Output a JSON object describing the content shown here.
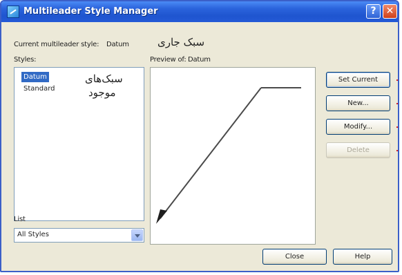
{
  "window": {
    "title": "Multileader Style Manager"
  },
  "titlebar_buttons": {
    "help": "?",
    "close": "✕"
  },
  "current_style": {
    "label": "Current multileader style:",
    "value": "Datum"
  },
  "annotations": {
    "current_style_fa": "سبک جاری",
    "styles_fa_line1": "سبک‌های",
    "styles_fa_line2": "موجود"
  },
  "styles": {
    "label": "Styles:",
    "items": [
      "Datum",
      "Standard"
    ],
    "selected": "Datum"
  },
  "preview": {
    "label": "Preview of:",
    "value": "Datum"
  },
  "list": {
    "label": "List",
    "selected": "All Styles"
  },
  "buttons": {
    "set_current": "Set Current",
    "new": "New...",
    "modify": "Modify...",
    "delete": "Delete",
    "close": "Close",
    "help": "Help"
  },
  "colors": {
    "title_bar": "#2a63dc",
    "selection": "#316ac5",
    "annotation_pointer": "#d11f2b"
  }
}
